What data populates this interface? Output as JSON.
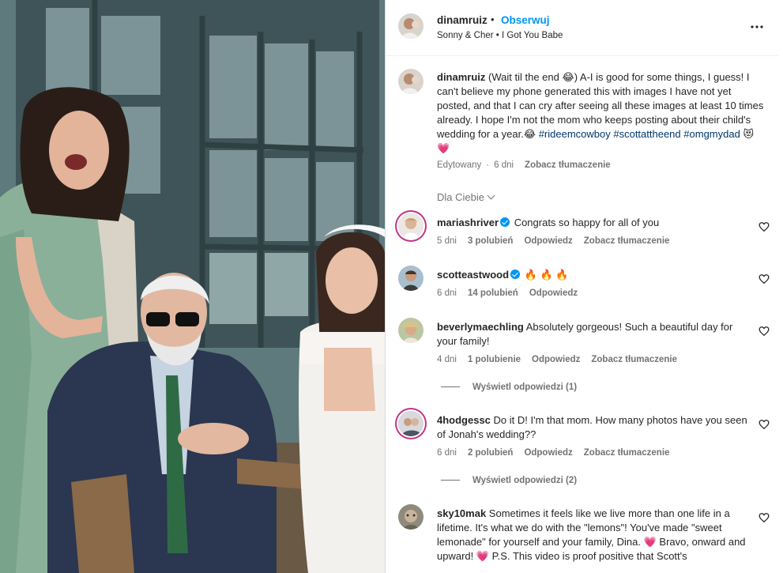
{
  "post": {
    "username": "dinamruiz",
    "separator": "•",
    "follow_label": "Obserwuj",
    "audio": "Sonny & Cher • I Got You Babe",
    "more_icon": "more-horizontal-icon"
  },
  "caption": {
    "username": "dinamruiz",
    "text_1": "(Wait til the end ",
    "emoji_1": "😂",
    "text_2": ") A-I is good for some things, I guess! I can't believe my phone generated this with images I have not yet posted, and that I can cry after seeing all these images at least 10 times already. I hope I'm not the mom who keeps posting about their child's wedding for a year.",
    "emoji_2": "😂",
    "hashtag_1": "#rideemcowboy",
    "hashtag_2": "#scottattheend",
    "hashtag_3": "#omgmydad",
    "emoji_3": "😻",
    "emoji_4": "💗",
    "edited": "Edytowany",
    "separator": "·",
    "age": "6 dni",
    "translate": "Zobacz tłumaczenie"
  },
  "sort_label": "Dla Ciebie",
  "comments": [
    {
      "username": "mariashriver",
      "verified": true,
      "text": "Congrats so happy for all of you",
      "age": "5 dni",
      "likes": "3 polubień",
      "reply": "Odpowiedz",
      "translate": "Zobacz tłumaczenie"
    },
    {
      "username": "scotteastwood",
      "verified": true,
      "text": "🔥 🔥 🔥",
      "age": "6 dni",
      "likes": "14 polubień",
      "reply": "Odpowiedz"
    },
    {
      "username": "beverlymaechling",
      "verified": false,
      "text": "Absolutely gorgeous! Such a beautiful day for your family!",
      "age": "4 dni",
      "likes": "1 polubienie",
      "reply": "Odpowiedz",
      "translate": "Zobacz tłumaczenie",
      "view_replies": "Wyświetl odpowiedzi (1)"
    },
    {
      "username": "4hodgessc",
      "verified": false,
      "text": "Do it D! I'm that mom. How many photos have you seen of Jonah's wedding??",
      "age": "6 dni",
      "likes": "2 polubień",
      "reply": "Odpowiedz",
      "translate": "Zobacz tłumaczenie",
      "view_replies": "Wyświetl odpowiedzi (2)"
    },
    {
      "username": "sky10mak",
      "verified": false,
      "text_1": "Sometimes it feels like we live more than one life in a lifetime. It's what we do with the \"lemons\"! You've made \"sweet lemonade\" for yourself and your family, Dina. ",
      "emoji_1": "💗",
      "text_2": " Bravo, onward and upward! ",
      "emoji_2": "💗",
      "text_3": " P.S. This video is proof positive that Scott's"
    }
  ],
  "colors": {
    "link_blue": "#0095f6",
    "hashtag_blue": "#00376b",
    "secondary_text": "#737373",
    "primary_text": "#262626",
    "story_ring": "#c13584"
  }
}
